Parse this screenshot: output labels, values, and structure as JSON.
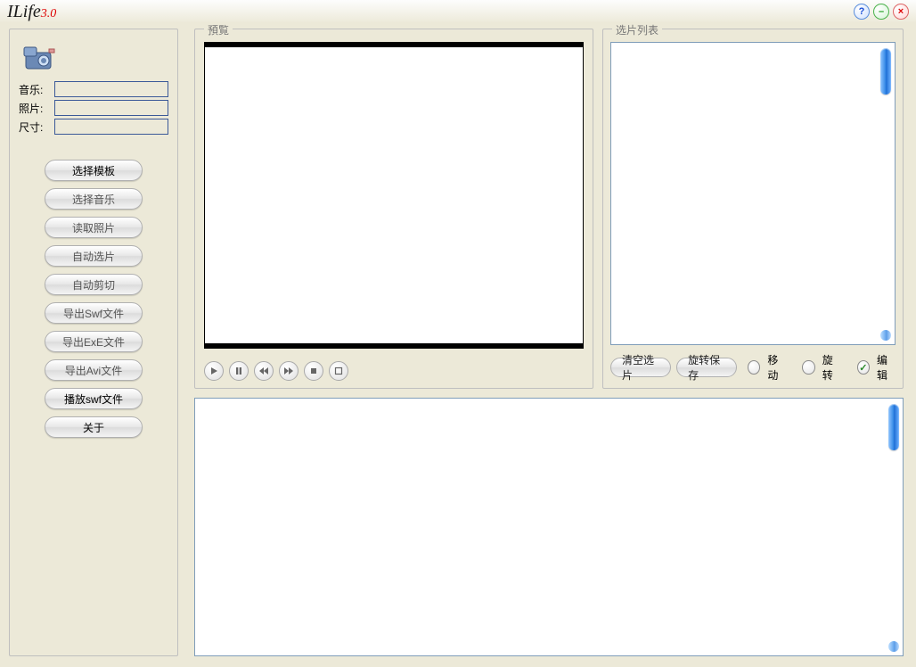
{
  "app": {
    "name": "ILife",
    "version": "3.0"
  },
  "title_buttons": {
    "help": "?",
    "min": "–",
    "close": "×"
  },
  "sidebar": {
    "labels": {
      "music": "音乐:",
      "photo": "照片:",
      "size": "尺寸:"
    },
    "values": {
      "music": "",
      "photo": "",
      "size": ""
    },
    "buttons": [
      {
        "id": "choose-template",
        "label": "选择模板",
        "enabled": true
      },
      {
        "id": "choose-music",
        "label": "选择音乐",
        "enabled": false
      },
      {
        "id": "read-photos",
        "label": "读取照片",
        "enabled": false
      },
      {
        "id": "auto-select",
        "label": "自动选片",
        "enabled": false
      },
      {
        "id": "auto-crop",
        "label": "自动剪切",
        "enabled": false
      },
      {
        "id": "export-swf",
        "label": "导出Swf文件",
        "enabled": false
      },
      {
        "id": "export-exe",
        "label": "导出ExE文件",
        "enabled": false
      },
      {
        "id": "export-avi",
        "label": "导出Avi文件",
        "enabled": false
      },
      {
        "id": "play-swf",
        "label": "播放swf文件",
        "enabled": true
      },
      {
        "id": "about",
        "label": "关于",
        "enabled": true
      }
    ]
  },
  "preview": {
    "legend": "預覧"
  },
  "selection": {
    "legend": "选片列表",
    "clear": "清空选片",
    "rotate_save": "旋转保存",
    "radios": {
      "move": "移动",
      "rotate": "旋转",
      "edit": "编辑",
      "selected": "edit"
    }
  },
  "transport": {
    "play": "▶",
    "pause": "❚❚",
    "prev": "◀◀",
    "next": "▶▶",
    "stop": "■",
    "full": "⛶"
  }
}
